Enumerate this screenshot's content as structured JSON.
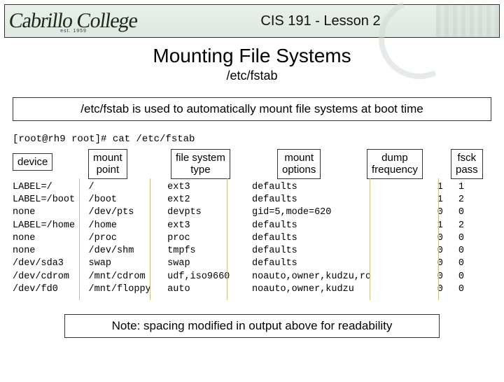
{
  "banner": {
    "logo_text": "Cabrillo College",
    "logo_sub": "est. 1959",
    "title": "CIS 191 - Lesson 2"
  },
  "page": {
    "title": "Mounting File Systems",
    "subtitle": "/etc/fstab"
  },
  "callout": "/etc/fstab is used to automatically mount file systems at boot time",
  "command": "[root@rh9 root]# cat /etc/fstab",
  "labels": {
    "device": "device",
    "mount_point": "mount\npoint",
    "fs_type": "file system\ntype",
    "options": "mount\noptions",
    "dump": "dump\nfrequency",
    "fsck": "fsck\npass"
  },
  "fstab": {
    "rows": [
      {
        "device": "LABEL=/",
        "mount": "/",
        "type": "ext3",
        "options": "defaults",
        "dump": "1",
        "fsck": "1"
      },
      {
        "device": "LABEL=/boot",
        "mount": "/boot",
        "type": "ext2",
        "options": "defaults",
        "dump": "1",
        "fsck": "2"
      },
      {
        "device": "none",
        "mount": "/dev/pts",
        "type": "devpts",
        "options": "gid=5,mode=620",
        "dump": "0",
        "fsck": "0"
      },
      {
        "device": "LABEL=/home",
        "mount": "/home",
        "type": "ext3",
        "options": "defaults",
        "dump": "1",
        "fsck": "2"
      },
      {
        "device": "none",
        "mount": "/proc",
        "type": "proc",
        "options": "defaults",
        "dump": "0",
        "fsck": "0"
      },
      {
        "device": "none",
        "mount": "/dev/shm",
        "type": "tmpfs",
        "options": "defaults",
        "dump": "0",
        "fsck": "0"
      },
      {
        "device": "/dev/sda3",
        "mount": "swap",
        "type": "swap",
        "options": "defaults",
        "dump": "0",
        "fsck": "0"
      },
      {
        "device": "/dev/cdrom",
        "mount": "/mnt/cdrom",
        "type": "udf,iso9660",
        "options": "noauto,owner,kudzu,ro",
        "dump": "0",
        "fsck": "0"
      },
      {
        "device": "/dev/fd0",
        "mount": "/mnt/floppy",
        "type": "auto",
        "options": "noauto,owner,kudzu",
        "dump": "0",
        "fsck": "0"
      }
    ]
  },
  "note": "Note: spacing modified in output above for readability"
}
